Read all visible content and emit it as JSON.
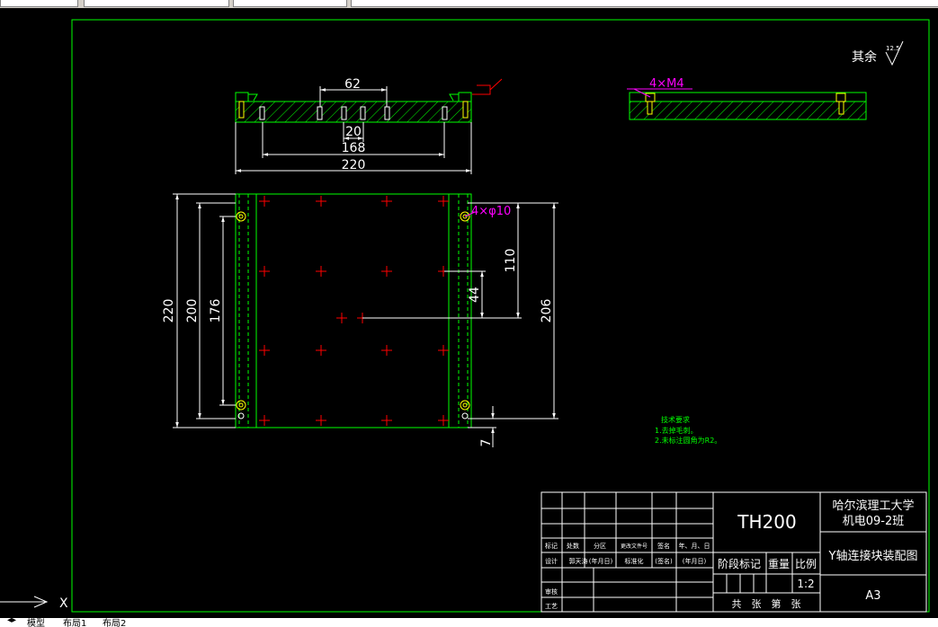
{
  "colors": {
    "frame": "#00ff00",
    "dim": "#ffffff",
    "hidden": "#ff0000",
    "callout": "#ff00ff",
    "note": "#00ff00",
    "text": "#ffffff",
    "background": "#000000"
  },
  "toolbar_fields": [
    "",
    "",
    "",
    ""
  ],
  "tabs": [
    "模型",
    "布局1",
    "布局2"
  ],
  "roughness": {
    "label": "其余",
    "value": "12.5"
  },
  "front_view": {
    "dims": {
      "width_62": "62",
      "width_20": "20",
      "width_168": "168",
      "width_220": "220"
    }
  },
  "side_view": {
    "callout": "4×M4"
  },
  "plan_view": {
    "callout": "4×φ10",
    "dims": {
      "h220": "220",
      "h200": "200",
      "h176": "176",
      "h110": "110",
      "h44": "44",
      "h206": "206",
      "h7": "7"
    }
  },
  "tech_notes": {
    "title": "技术要求",
    "lines": [
      "1.去掉毛刺。",
      "2.未标注圆角为R2。"
    ]
  },
  "title_block": {
    "drawing_code": "TH200",
    "school": "哈尔滨理工大学",
    "class": "机电09-2班",
    "drawing_name": "Y轴连接块装配图",
    "sheet_size": "A3",
    "scale_label": "比例",
    "scale": "1:2",
    "weight_label": "重量",
    "stage_label": "阶段标记",
    "sheet_footer": "共　张　第　张",
    "header_cells": [
      "标记",
      "处数",
      "分区",
      "更改文件号",
      "签名",
      "年、月、日"
    ],
    "design_cells": [
      "设计",
      "郭天涛",
      "(年月日)",
      "标准化",
      "(签名)",
      "(年月日)"
    ],
    "review_label": "审核",
    "process_label": "工艺"
  }
}
